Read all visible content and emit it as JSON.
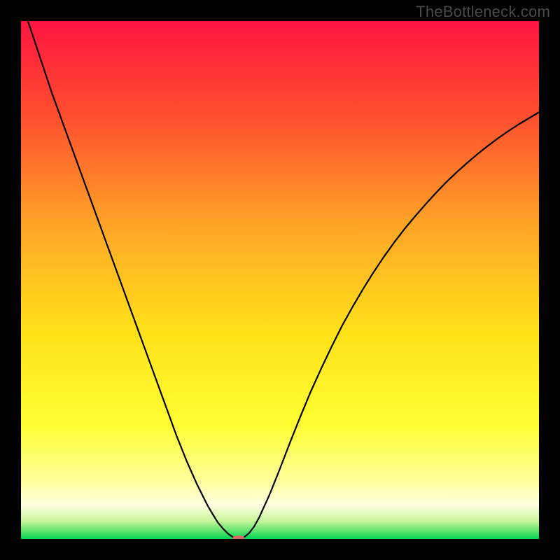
{
  "watermark": "TheBottleneck.com",
  "chart_data": {
    "type": "line",
    "title": "",
    "xlabel": "",
    "ylabel": "",
    "xlim": [
      0,
      100
    ],
    "ylim": [
      0,
      100
    ],
    "grid": false,
    "legend": false,
    "gradient_stops": [
      {
        "offset": 0.0,
        "color": "#ff163f"
      },
      {
        "offset": 0.18,
        "color": "#ff4d2f"
      },
      {
        "offset": 0.4,
        "color": "#ffa726"
      },
      {
        "offset": 0.6,
        "color": "#ffe11a"
      },
      {
        "offset": 0.78,
        "color": "#ffff33"
      },
      {
        "offset": 0.89,
        "color": "#ffffa0"
      },
      {
        "offset": 0.935,
        "color": "#ffffe0"
      },
      {
        "offset": 0.965,
        "color": "#c8f59a"
      },
      {
        "offset": 0.985,
        "color": "#5be36d"
      },
      {
        "offset": 1.0,
        "color": "#00d455"
      }
    ],
    "series": [
      {
        "name": "bottleneck-curve",
        "color": "#000000",
        "width": 2.2,
        "x": [
          0,
          2,
          4,
          6,
          8,
          10,
          12,
          14,
          16,
          18,
          20,
          22,
          24,
          26,
          28,
          30,
          32,
          34,
          36,
          37,
          38,
          39,
          40,
          41,
          42,
          43,
          44,
          45,
          46,
          48,
          50,
          52,
          54,
          56,
          58,
          60,
          62,
          64,
          66,
          68,
          70,
          72,
          74,
          76,
          78,
          80,
          82,
          84,
          86,
          88,
          90,
          92,
          94,
          96,
          98,
          100
        ],
        "y": [
          104,
          98,
          92,
          86,
          80.5,
          75,
          69.5,
          64,
          58.5,
          53,
          47.5,
          42,
          36.5,
          31,
          25.5,
          20,
          15,
          10.5,
          6.5,
          4.8,
          3.2,
          2.0,
          1.0,
          0.3,
          0.0,
          0.3,
          1.1,
          2.4,
          4.2,
          8.6,
          13.6,
          18.8,
          23.8,
          28.6,
          33.0,
          37.2,
          41.2,
          44.8,
          48.2,
          51.4,
          54.4,
          57.2,
          59.8,
          62.2,
          64.5,
          66.7,
          68.8,
          70.7,
          72.5,
          74.2,
          75.8,
          77.3,
          78.7,
          80.0,
          81.2,
          82.4
        ]
      }
    ],
    "marker": {
      "shape": "rounded-rect",
      "x": 42,
      "y": 0,
      "width_units": 2.4,
      "height_units": 1.3,
      "color": "#d46a6a",
      "radius_units": 0.7
    }
  }
}
